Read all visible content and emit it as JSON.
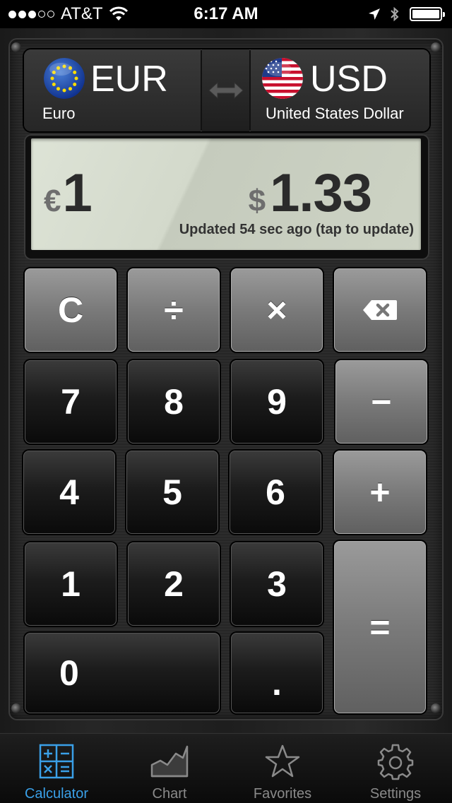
{
  "status_bar": {
    "carrier": "AT&T",
    "time": "6:17 AM",
    "signal_bars": 3,
    "signal_max": 5
  },
  "converter": {
    "from": {
      "code": "EUR",
      "name": "Euro",
      "symbol": "€",
      "flag": "eu-flag-icon"
    },
    "to": {
      "code": "USD",
      "name": "United States Dollar",
      "symbol": "$",
      "flag": "us-flag-icon"
    },
    "swap_icon": "swap-arrows-icon"
  },
  "display": {
    "from_symbol": "€",
    "from_value": "1",
    "to_symbol": "$",
    "to_value": "1.33",
    "updated_text": "Updated 54 sec ago (tap to update)"
  },
  "keypad": {
    "clear": "C",
    "divide": "÷",
    "multiply": "×",
    "backspace_icon": "backspace-icon",
    "seven": "7",
    "eight": "8",
    "nine": "9",
    "minus": "−",
    "four": "4",
    "five": "5",
    "six": "6",
    "plus": "+",
    "one": "1",
    "two": "2",
    "three": "3",
    "equals": "=",
    "zero": "0",
    "decimal": "."
  },
  "tabs": [
    {
      "label": "Calculator",
      "icon": "calculator-icon",
      "active": true
    },
    {
      "label": "Chart",
      "icon": "chart-icon",
      "active": false
    },
    {
      "label": "Favorites",
      "icon": "star-icon",
      "active": false
    },
    {
      "label": "Settings",
      "icon": "gear-icon",
      "active": false
    }
  ],
  "colors": {
    "accent": "#3aa0e8",
    "display_bg": "#d3d9cb"
  }
}
